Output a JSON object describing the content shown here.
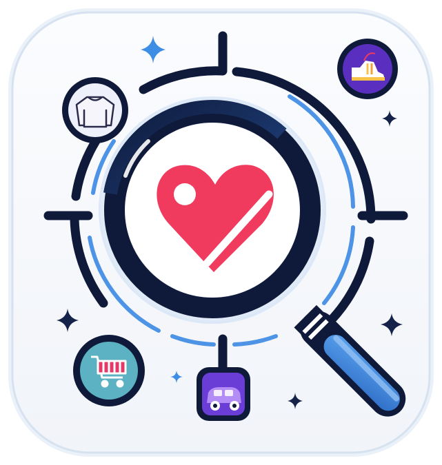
{
  "app_icon": {
    "colors": {
      "tile_background": "#f7f8fb",
      "tile_border": "#dfe7f2",
      "navy": "#0f1a3a",
      "ring_blue": "#3b7fd6",
      "ring_light_blue": "#4d93e6",
      "heart": "#f03a5e",
      "heart_highlight": "#ffffff",
      "sparkle_blue": "#3f8ee6",
      "sparkle_navy": "#15224a",
      "cart_bg": "#5cb2c2",
      "car_bg": "#6a3ed6",
      "shoe_bg": "#5a2fbf",
      "sweater_bg": "#eef1fb"
    },
    "icons": {
      "center": "heart-icon",
      "magnifier": "magnifying-glass-icon",
      "top_left": "sweater-icon",
      "top_right": "shoe-icon",
      "bottom_left": "shopping-cart-icon",
      "bottom_center": "toy-car-icon"
    }
  }
}
